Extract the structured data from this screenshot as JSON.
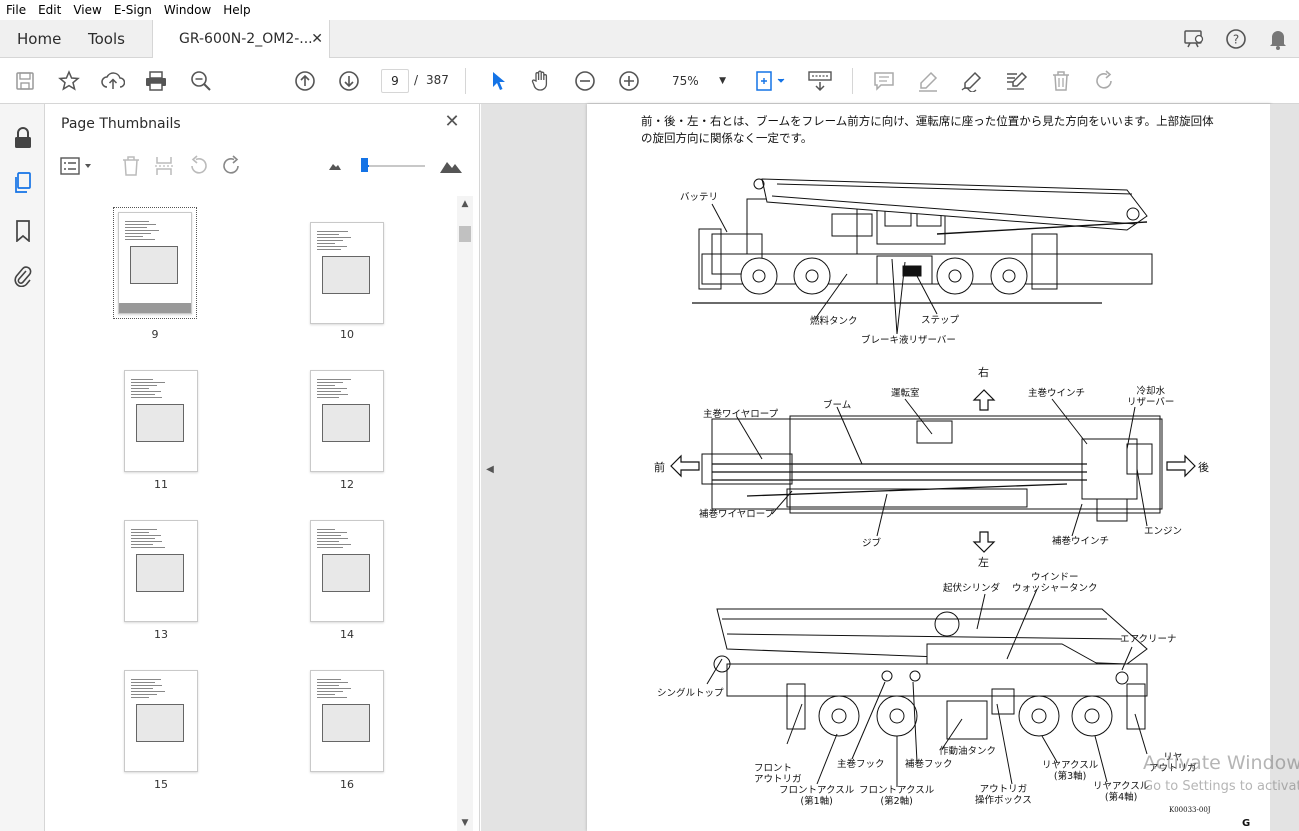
{
  "menu": [
    "File",
    "Edit",
    "View",
    "E-Sign",
    "Window",
    "Help"
  ],
  "tabs": {
    "home": "Home",
    "tools": "Tools",
    "document": "GR-600N-2_OM2-...",
    "close": "✕"
  },
  "toolbar": {
    "page_current": "9",
    "page_sep": "/",
    "page_total": "387",
    "zoom": "75%"
  },
  "panel": {
    "title": "Page Thumbnails",
    "close": "✕"
  },
  "thumbnails": [
    {
      "label": "9",
      "selected": true
    },
    {
      "label": "10"
    },
    {
      "label": "11"
    },
    {
      "label": "12"
    },
    {
      "label": "13"
    },
    {
      "label": "14"
    },
    {
      "label": "15"
    },
    {
      "label": "16"
    }
  ],
  "document": {
    "intro": "前・後・左・右とは、ブームをフレーム前方に向け、運転席に座った位置から見た方向をいいます。上部旋回体の旋回方向に関係なく一定です。",
    "figure_code": "K00033-00J",
    "corner_text": "G",
    "side_view_labels": {
      "battery": "バッテリ",
      "fuel_tank": "燃料タンク",
      "step": "ステップ",
      "brake_reservoir": "ブレーキ液リザーバー"
    },
    "top_view_labels": {
      "right": "右",
      "left": "左",
      "front": "前",
      "rear": "後",
      "main_wire": "主巻ワイヤロープ",
      "boom": "ブーム",
      "cab": "運転室",
      "main_winch": "主巻ウインチ",
      "coolant_reservoir": "冷却水\nリザーバー",
      "aux_wire": "補巻ワイヤロープ",
      "jib": "ジブ",
      "aux_winch": "補巻ウインチ",
      "engine": "エンジン"
    },
    "rear_view_labels": {
      "derrick_cylinder": "起伏シリンダ",
      "washer_tank": "ウインドー\nウォッシャータンク",
      "air_cleaner": "エアクリーナ",
      "single_top": "シングルトップ",
      "front_outrigger": "フロント\nアウトリガ",
      "main_hook": "主巻フック",
      "front_axle1": "フロントアクスル\n(第1軸)",
      "front_axle2": "フロントアクスル\n(第2軸)",
      "aux_hook": "補巻フック",
      "hydraulic_tank": "作動油タンク",
      "outrigger_box": "アウトリガ\n操作ボックス",
      "rear_axle3": "リヤアクスル\n(第3軸)",
      "rear_axle4": "リヤアクスル\n(第4軸)",
      "rear_outrigger": "リヤ\nアウトリガ"
    }
  },
  "watermark": {
    "line1": "Activate Windows",
    "line2": "Go to Settings to activate"
  }
}
